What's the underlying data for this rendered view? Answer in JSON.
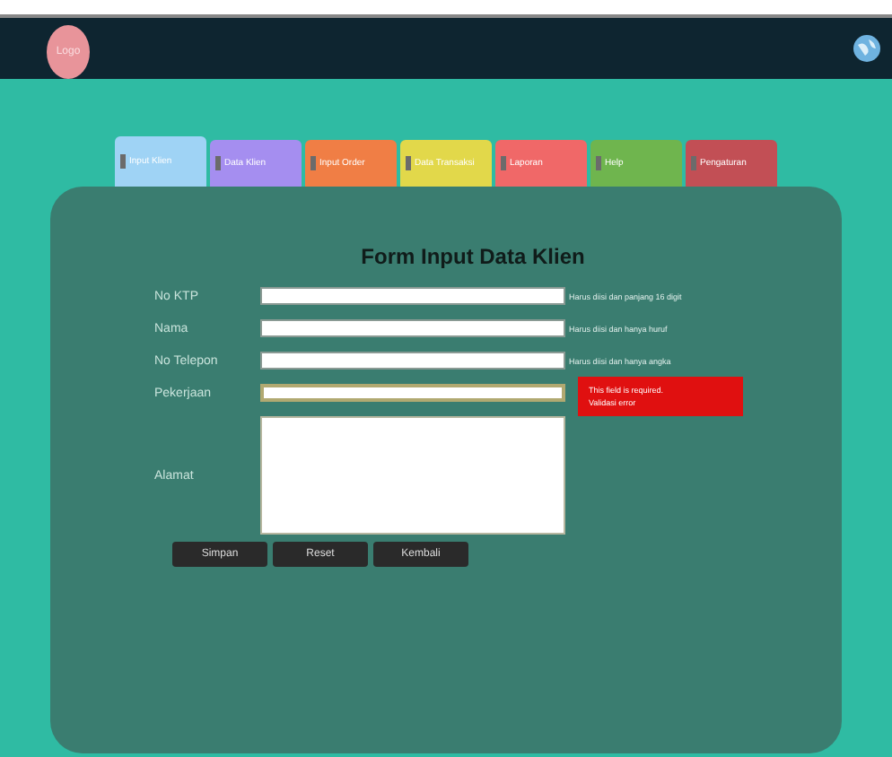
{
  "header": {
    "logo": "Logo"
  },
  "tabs": [
    {
      "label": "Input Klien",
      "color": "#9fd3f5",
      "selected": true
    },
    {
      "label": "Data Klien",
      "color": "#a58ef0",
      "selected": false
    },
    {
      "label": "Input Order",
      "color": "#f07e45",
      "selected": false
    },
    {
      "label": "Data Transaksi",
      "color": "#e2d84a",
      "selected": false
    },
    {
      "label": "Laporan",
      "color": "#f06868",
      "selected": false
    },
    {
      "label": "Help",
      "color": "#6fb54e",
      "selected": false
    },
    {
      "label": "Pengaturan",
      "color": "#c24f55",
      "selected": false
    }
  ],
  "form": {
    "title": "Form Input Data Klien",
    "fields": [
      {
        "label": "No KTP",
        "kind": "input",
        "hint": "Harus diisi dan panjang 16 digit",
        "error": false
      },
      {
        "label": "Nama",
        "kind": "input",
        "hint": "Harus diisi dan hanya huruf",
        "error": false
      },
      {
        "label": "No Telepon",
        "kind": "input",
        "hint": "Harus diisi dan hanya angka",
        "error": false
      },
      {
        "label": "Pekerjaan",
        "kind": "input",
        "error": true
      },
      {
        "label": "Alamat",
        "kind": "textarea",
        "error": false
      }
    ],
    "error_tooltip": [
      "This field is required.",
      "Validasi error"
    ],
    "buttons": [
      "Simpan",
      "Reset",
      "Kembali"
    ]
  }
}
